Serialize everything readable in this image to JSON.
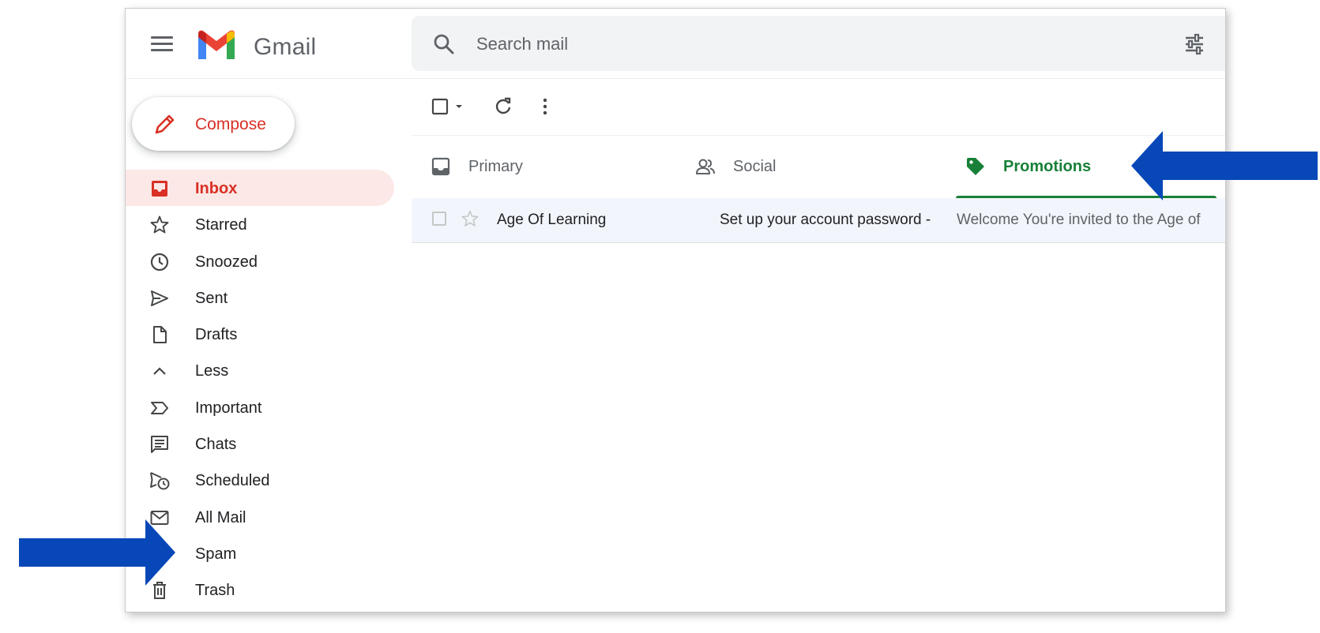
{
  "app": {
    "brand": "Gmail"
  },
  "search": {
    "placeholder": "Search mail",
    "icon": "search-icon",
    "filter_icon": "tune-icon"
  },
  "compose": {
    "label": "Compose"
  },
  "sidebar": {
    "items": [
      {
        "label": "Inbox",
        "icon": "inbox-icon",
        "active": true
      },
      {
        "label": "Starred",
        "icon": "star-icon"
      },
      {
        "label": "Snoozed",
        "icon": "clock-icon"
      },
      {
        "label": "Sent",
        "icon": "send-icon"
      },
      {
        "label": "Drafts",
        "icon": "draft-icon"
      },
      {
        "label": "Less",
        "icon": "chevron-up-icon"
      },
      {
        "label": "Important",
        "icon": "important-icon"
      },
      {
        "label": "Chats",
        "icon": "chat-icon"
      },
      {
        "label": "Scheduled",
        "icon": "scheduled-send-icon"
      },
      {
        "label": "All Mail",
        "icon": "mail-icon"
      },
      {
        "label": "Spam",
        "icon": "spam-icon"
      },
      {
        "label": "Trash",
        "icon": "trash-icon"
      }
    ]
  },
  "tabs": [
    {
      "label": "Primary",
      "icon": "inbox-tray-icon"
    },
    {
      "label": "Social",
      "icon": "people-icon"
    },
    {
      "label": "Promotions",
      "icon": "tag-icon",
      "active": true
    }
  ],
  "emails": [
    {
      "sender": "Age Of Learning",
      "subject": "Set up your account password -",
      "snippet": "Welcome You're invited to the Age of"
    }
  ],
  "colors": {
    "accent_red": "#d93025",
    "promotions_green": "#188038",
    "annotation_arrow": "#0747b8",
    "inbox_highlight": "#fce8e6"
  }
}
